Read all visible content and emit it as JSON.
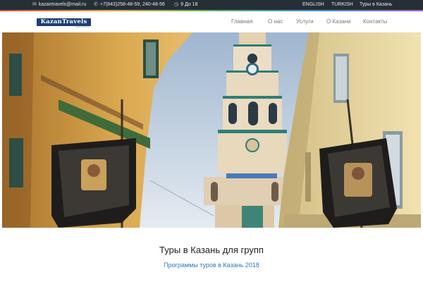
{
  "topbar": {
    "email": {
      "icon": "envelope-icon",
      "text": "kazantravels@mail.ru"
    },
    "phone": {
      "icon": "phone-icon",
      "text": "+7(843)258-48-59, 240-48-56"
    },
    "hours": {
      "icon": "clock-icon",
      "text": "9 До 18"
    },
    "links": [
      "ENGLISH",
      "TURKISH",
      "Туры в Казань"
    ]
  },
  "header": {
    "logo": {
      "text": "KazanTravels",
      "subtext": "туристическое"
    },
    "nav": [
      "Главная",
      "О нас",
      "Услуги",
      "О Казани",
      "Контакты"
    ]
  },
  "hero": {
    "image": "Kazan-church-bell-tower-street-photo",
    "colors": {
      "sky": "#cfd9e4",
      "left_wall": "#d9a74e",
      "right_wall": "#e8d9a3",
      "tower": "#e6d5b8",
      "tower_accent": "#2e7f75"
    }
  },
  "main": {
    "heading": "Туры в Казань для групп",
    "subheading": "Программы туров в Казань 2018"
  },
  "colors": {
    "topbar_bg": "#262e36",
    "link_blue": "#2c78c6",
    "nav_text": "#737b83"
  }
}
